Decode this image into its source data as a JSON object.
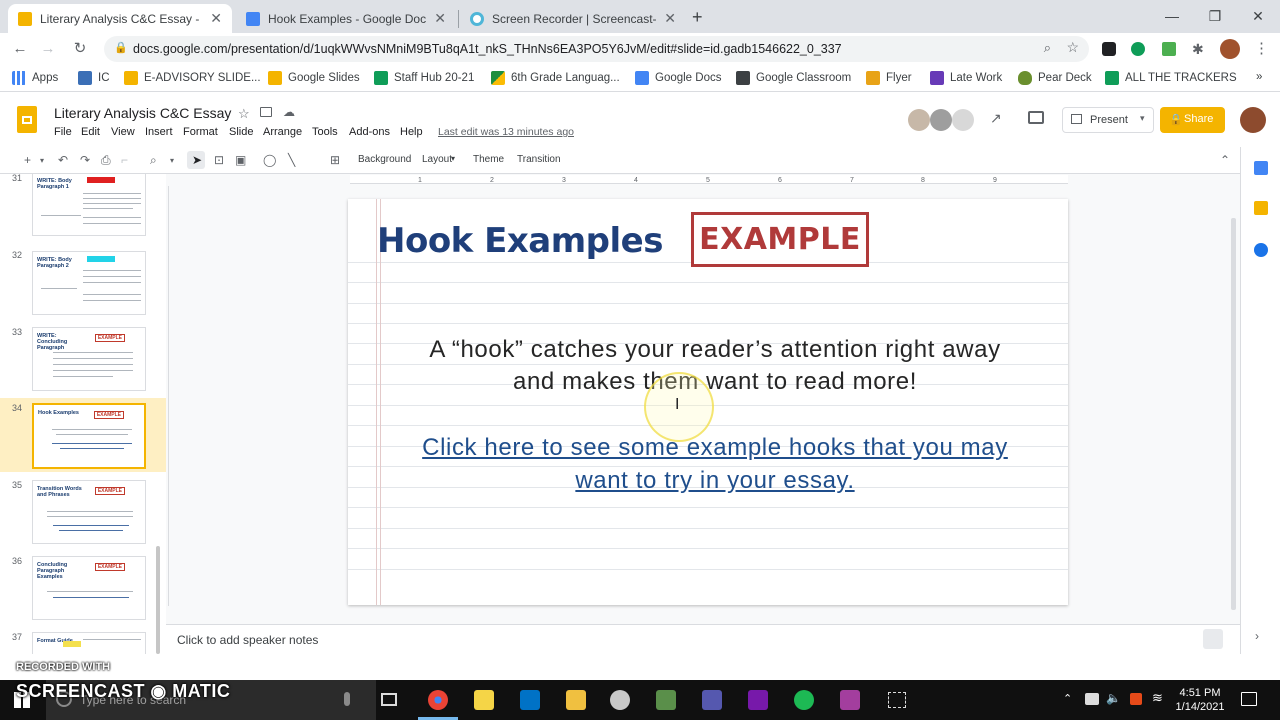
{
  "browser": {
    "tabs": [
      {
        "label": "Literary Analysis C&C Essay - Go",
        "active": true,
        "icon": "slides-icon",
        "color": "#f4b400"
      },
      {
        "label": "Hook Examples - Google Docs",
        "active": false,
        "icon": "docs-icon",
        "color": "#4285f4"
      },
      {
        "label": "Screen Recorder | Screencast-O-",
        "active": false,
        "icon": "screencast-icon",
        "color": "#4fb6d8"
      }
    ],
    "new_tab": "+",
    "url": "docs.google.com/presentation/d/1uqkWWvsNMniM9BTu8qA1t_nkS_THnNs6EA3PO5Y6JvM/edit#slide=id.gadb1546622_0_337",
    "bookmarks": [
      {
        "label": "Apps",
        "color": "#4285f4"
      },
      {
        "label": "IC",
        "color": "#3b6fb6"
      },
      {
        "label": "E-ADVISORY SLIDE...",
        "color": "#f4b400"
      },
      {
        "label": "Google Slides",
        "color": "#f4b400"
      },
      {
        "label": "Staff Hub 20-21",
        "color": "#0f9d58"
      },
      {
        "label": "6th Grade Languag...",
        "color": "#1e8e3e"
      },
      {
        "label": "Google Docs",
        "color": "#4285f4"
      },
      {
        "label": "Google Classroom",
        "color": "#3c4043"
      },
      {
        "label": "Flyer",
        "color": "#e8a317"
      },
      {
        "label": "Late Work",
        "color": "#673ab7"
      },
      {
        "label": "Pear Deck",
        "color": "#6a8f2e"
      },
      {
        "label": "ALL THE TRACKERS",
        "color": "#0f9d58"
      }
    ]
  },
  "slides": {
    "title": "Literary Analysis C&C Essay",
    "menu": [
      "File",
      "Edit",
      "View",
      "Insert",
      "Format",
      "Slide",
      "Arrange",
      "Tools",
      "Add-ons",
      "Help"
    ],
    "last_edit": "Last edit was 13 minutes ago",
    "present_label": "Present",
    "share_label": "Share",
    "toolbar": {
      "background": "Background",
      "layout": "Layout",
      "theme": "Theme",
      "transition": "Transition"
    },
    "ruler_ticks": [
      "1",
      "2",
      "3",
      "4",
      "5",
      "6",
      "7",
      "8",
      "9"
    ],
    "thumbnails": [
      {
        "num": "31",
        "title": "WRITE: Body Paragraph 1",
        "badge": "",
        "selected": false
      },
      {
        "num": "32",
        "title": "WRITE: Body Paragraph 2",
        "badge": "",
        "selected": false
      },
      {
        "num": "33",
        "title": "WRITE: Concluding Paragraph",
        "badge": "EXAMPLE",
        "selected": false
      },
      {
        "num": "34",
        "title": "Hook Examples",
        "badge": "EXAMPLE",
        "selected": true
      },
      {
        "num": "35",
        "title": "Transition Words and Phrases",
        "badge": "EXAMPLE",
        "selected": false
      },
      {
        "num": "36",
        "title": "Concluding Paragraph Examples",
        "badge": "EXAMPLE",
        "selected": false
      },
      {
        "num": "37",
        "title": "Format Guide",
        "badge": "",
        "selected": false
      }
    ],
    "slide": {
      "title": "Hook Examples",
      "stamp": "EXAMPLE",
      "body": "A “hook” catches your reader’s attention right away and makes them want to read more!",
      "link": "Click here to see some example hooks that you may want to try in your essay."
    },
    "speaker_notes": "Click to add speaker notes"
  },
  "taskbar": {
    "search_placeholder": "Type here to search",
    "time": "4:51 PM",
    "date": "1/14/2021"
  },
  "watermark": {
    "small": "RECORDED WITH",
    "big": "SCREENCAST ◉ MATIC"
  }
}
